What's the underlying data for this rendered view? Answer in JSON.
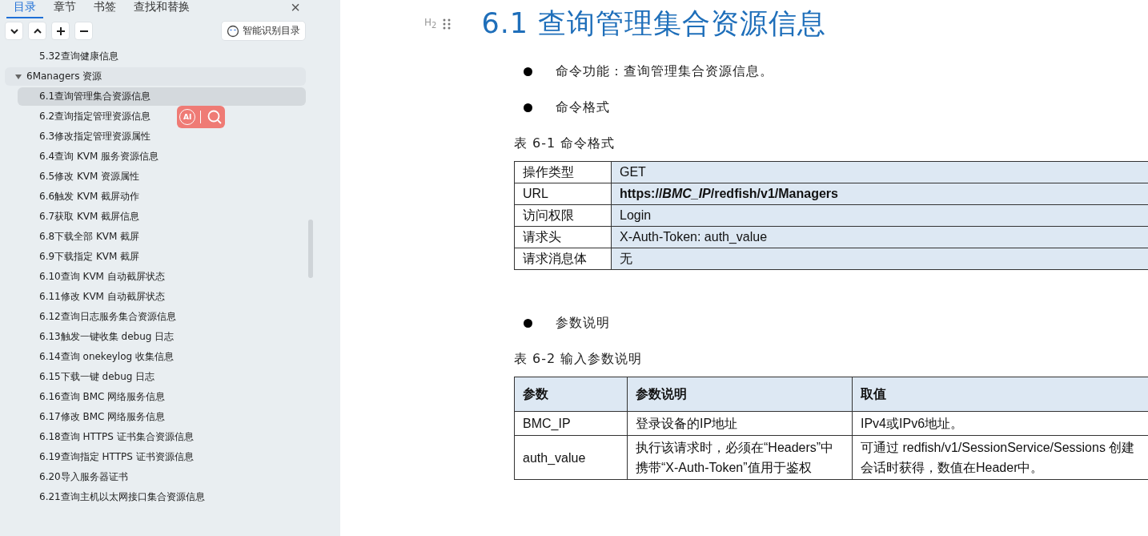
{
  "sidebar": {
    "tabs": [
      {
        "label": "目录",
        "selected": true
      },
      {
        "label": "章节",
        "selected": false
      },
      {
        "label": "书签",
        "selected": false
      },
      {
        "label": "查找和替换",
        "selected": false
      }
    ],
    "close": "×",
    "tools": [
      {
        "kind": "down"
      },
      {
        "kind": "up"
      },
      {
        "kind": "plus"
      },
      {
        "kind": "minus"
      }
    ],
    "smart_button": "智能识别目录",
    "tree": [
      {
        "label": "5.32查询健康信息",
        "selected": false
      },
      {
        "label": "6Managers 资源",
        "selected": false,
        "expanded": true,
        "children": [
          {
            "label": "6.1查询管理集合资源信息",
            "selected": true
          },
          {
            "label": "6.2查询指定管理资源信息",
            "selected": false
          },
          {
            "label": "6.3修改指定管理资源属性",
            "selected": false
          },
          {
            "label": "6.4查询 KVM 服务资源信息",
            "selected": false
          },
          {
            "label": "6.5修改 KVM 资源属性",
            "selected": false
          },
          {
            "label": "6.6触发 KVM 截屏动作",
            "selected": false
          },
          {
            "label": "6.7获取 KVM 截屏信息",
            "selected": false
          },
          {
            "label": "6.8下载全部 KVM 截屏",
            "selected": false
          },
          {
            "label": "6.9下载指定 KVM 截屏",
            "selected": false
          },
          {
            "label": "6.10查询 KVM 自动截屏状态",
            "selected": false
          },
          {
            "label": "6.11修改 KVM 自动截屏状态",
            "selected": false
          },
          {
            "label": "6.12查询日志服务集合资源信息",
            "selected": false
          },
          {
            "label": "6.13触发一键收集 debug 日志",
            "selected": false
          },
          {
            "label": "6.14查询 onekeylog 收集信息",
            "selected": false
          },
          {
            "label": "6.15下载一键 debug 日志",
            "selected": false
          },
          {
            "label": "6.16查询 BMC 网络服务信息",
            "selected": false
          },
          {
            "label": "6.17修改 BMC 网络服务信息",
            "selected": false
          },
          {
            "label": "6.18查询 HTTPS 证书集合资源信息",
            "selected": false
          },
          {
            "label": "6.19查询指定 HTTPS 证书资源信息",
            "selected": false
          },
          {
            "label": "6.20导入服务器证书",
            "selected": false
          },
          {
            "label": "6.21查询主机以太网接口集合资源信息",
            "selected": false
          }
        ]
      }
    ],
    "float_toolbar": {
      "ai_label": "AI"
    }
  },
  "document": {
    "heading_marker": "H$_{2}$",
    "heading_number": "6.1",
    "heading": "查询管理集合资源信息",
    "blocks": [
      {
        "kind": "bullet",
        "text": "命令功能：查询管理集合资源信息。"
      },
      {
        "kind": "bullet",
        "text": "命令格式"
      },
      {
        "kind": "caption",
        "text": "表 6-1  命令格式"
      },
      {
        "kind": "table1",
        "rows": [
          [
            "操作类型",
            "GET"
          ],
          [
            "URL",
            "**https://*BMC_IP*/redfish/v1/Managers**"
          ],
          [
            "访问权限",
            "Login"
          ],
          [
            "请求头",
            "X-Auth-Token: auth_value"
          ],
          [
            "请求消息体",
            "无"
          ]
        ]
      },
      {
        "kind": "bullet",
        "text": "参数说明"
      },
      {
        "kind": "caption",
        "text": "表 6-2  输入参数说明"
      },
      {
        "kind": "table2",
        "columns": [
          "参数",
          "参数说明",
          "取值"
        ],
        "rows": [
          [
            "BMC_IP",
            "登录设备的IP地址",
            "IPv4或IPv6地址。"
          ],
          [
            "auth_value",
            "执行该请求时，必须在“Headers”中携带“X-Auth-Token”值用于鉴权",
            "可通过 redfish/v1/SessionService/Sessions 创建会话时获得，数值在Header中。"
          ]
        ]
      }
    ]
  }
}
